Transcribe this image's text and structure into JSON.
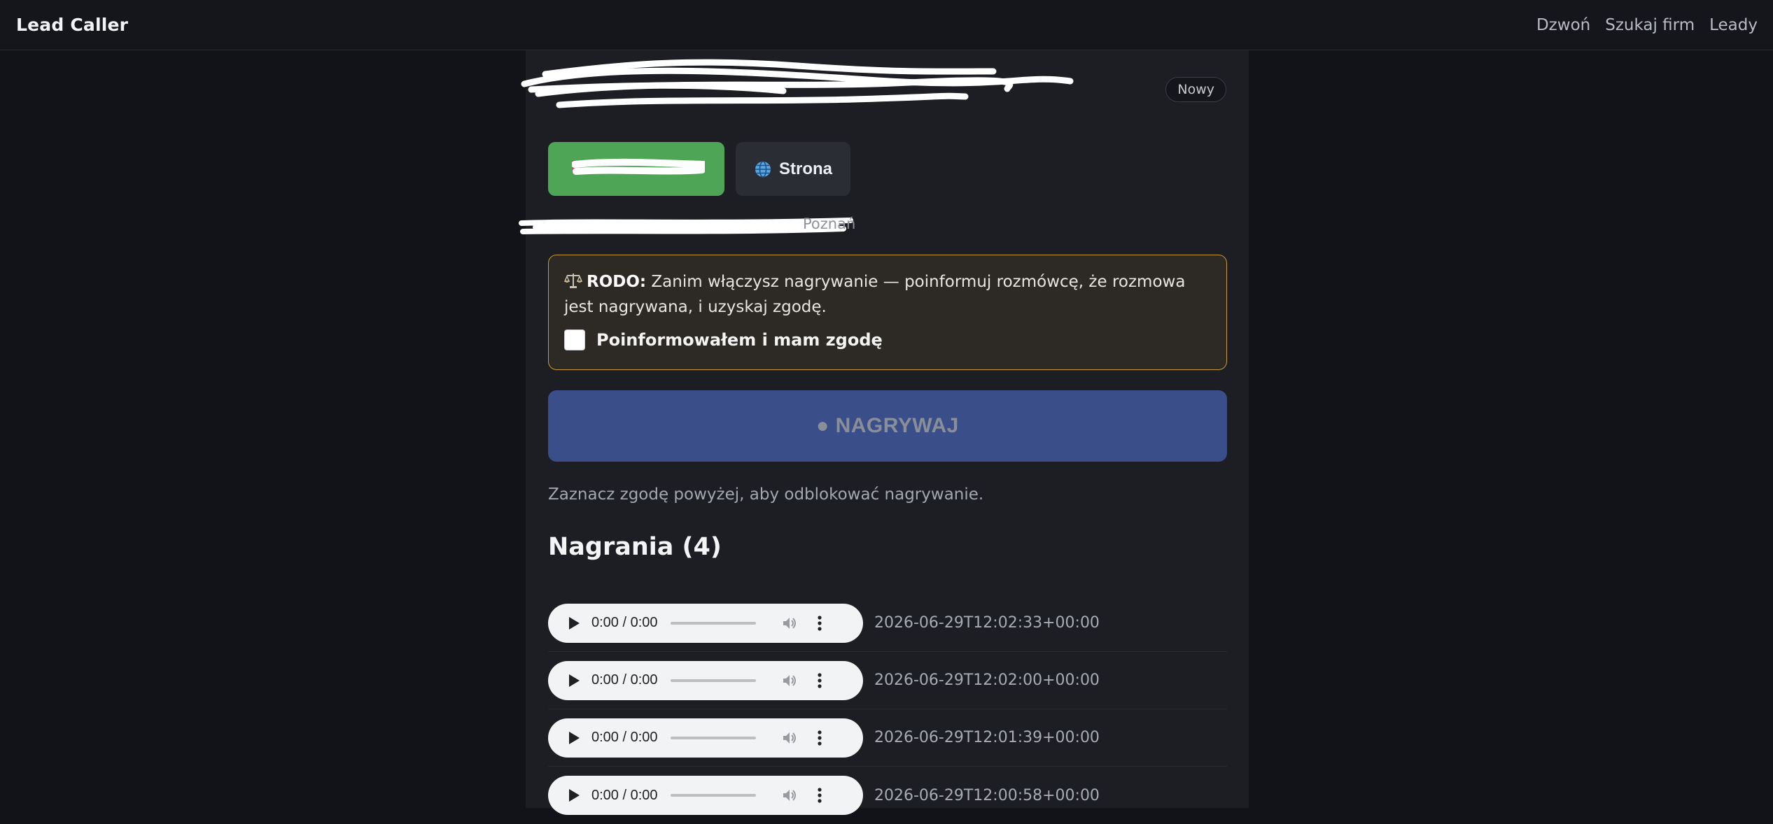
{
  "app": {
    "title": "Lead Caller"
  },
  "nav": {
    "items": [
      "Dzwoń",
      "Szukaj firm",
      "Leady"
    ]
  },
  "lead": {
    "status": "Nowy",
    "city_suffix": "Poznań"
  },
  "actions": {
    "site_label": "Strona"
  },
  "rodo": {
    "label": "RODO:",
    "text": " Zanim włączysz nagrywanie — poinformuj rozmówcę, że rozmowa jest nagrywana, i uzyskaj zgodę.",
    "consent_label": "Poinformowałem i mam zgodę",
    "consent_checked": false
  },
  "record": {
    "label": "● NAGRYWAJ",
    "hint": "Zaznacz zgodę powyżej, aby odblokować nagrywanie."
  },
  "recordings": {
    "heading": "Nagrania (4)",
    "items": [
      {
        "time": "0:00 / 0:00",
        "timestamp": "2026-06-29T12:02:33+00:00"
      },
      {
        "time": "0:00 / 0:00",
        "timestamp": "2026-06-29T12:02:00+00:00"
      },
      {
        "time": "0:00 / 0:00",
        "timestamp": "2026-06-29T12:01:39+00:00"
      },
      {
        "time": "0:00 / 0:00",
        "timestamp": "2026-06-29T12:00:58+00:00"
      }
    ]
  },
  "colors": {
    "accent_green": "#4fa556",
    "record_blue": "#3a4e8a",
    "rodo_border": "#c79a2e"
  },
  "icons": {
    "site": "globe-icon",
    "rodo": "scale-icon"
  }
}
